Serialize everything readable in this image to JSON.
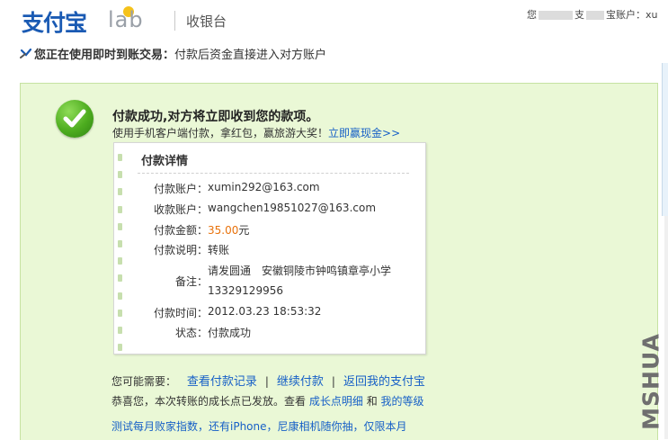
{
  "header": {
    "logo_text": "支付宝",
    "logo_lab": "lab",
    "section_title": "收银台",
    "user_prefix": "您",
    "user_mid": "支",
    "user_suffix": "宝账户：xu"
  },
  "notice": {
    "bold": "您正在使用即时到账交易：",
    "text": "付款后资金直接进入对方账户"
  },
  "success": {
    "title": "付款成功,对方将立即收到您的款项。",
    "promo_text": "使用手机客户端付款，拿红包，赢旅游大奖！",
    "promo_link": "立即赢现金>>"
  },
  "details": {
    "title": "付款详情",
    "rows": [
      {
        "label": "付款账户：",
        "value": "xumin292@163.com"
      },
      {
        "label": "收款账户：",
        "value": "wangchen19851027@163.com"
      },
      {
        "label": "付款金额：",
        "amount": "35.00",
        "unit": "元"
      },
      {
        "label": "付款说明：",
        "value": "转账"
      },
      {
        "label": "备注：",
        "value": "请发圆通　安徽铜陵市钟鸣镇章亭小学",
        "value2": "13329129956"
      },
      {
        "label": "付款时间：",
        "value": "2012.03.23 18:53:32"
      },
      {
        "label": "状态：",
        "value": "付款成功"
      }
    ]
  },
  "links": {
    "prefix": "您可能需要：",
    "view_records": "查看付款记录",
    "continue_pay": "继续付款",
    "back_home": "返回我的支付宝",
    "separator": "|"
  },
  "growth": {
    "text": "恭喜您，本次转账的成长点已发放。查看",
    "link1": "成长点明细",
    "and": "和",
    "link2": "我的等级"
  },
  "lottery": "测试每月败家指数，还有iPhone，尼康相机随你抽，仅限本月",
  "watermark": "MSHUA",
  "colors": {
    "link": "#1760c7",
    "amount": "#e8720c",
    "panel_bg": "#eaf8d6",
    "success_icon": "#4dac1f"
  },
  "icons": {
    "success": "check-icon",
    "notice": "alipay-bird-icon"
  }
}
